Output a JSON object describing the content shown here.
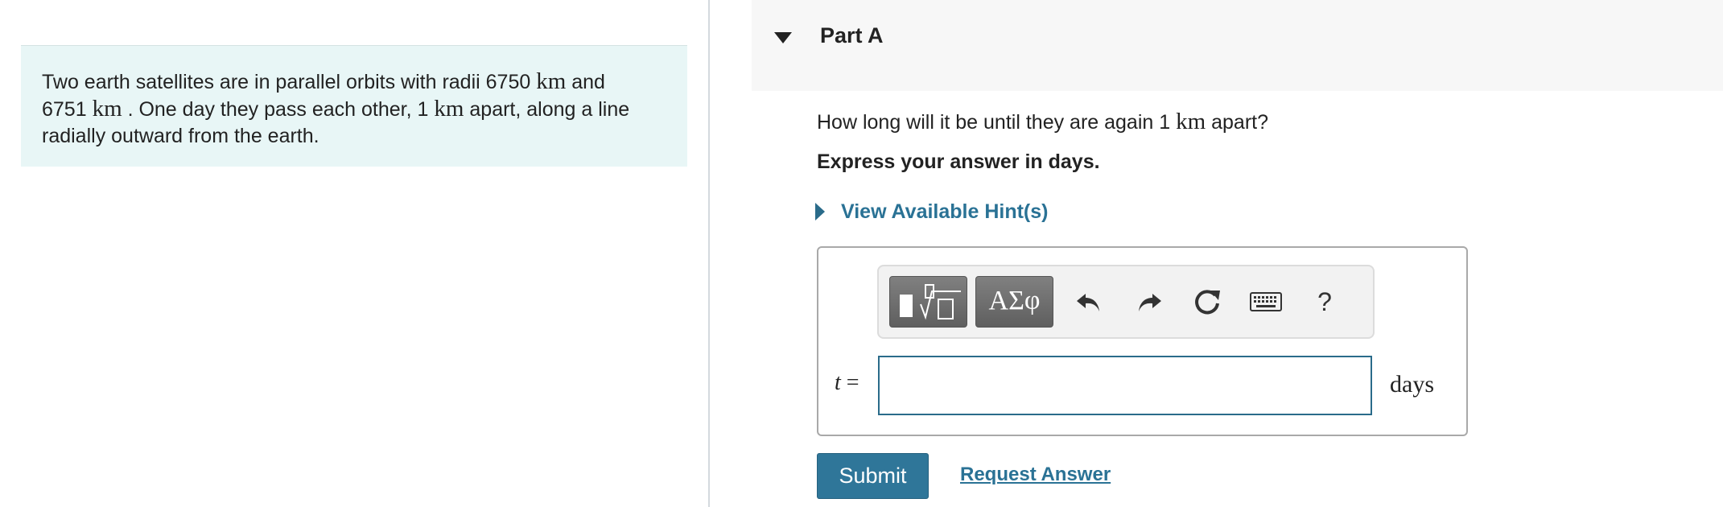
{
  "problem": {
    "line1_pre": "Two earth satellites are in parallel orbits with radii 6750 ",
    "unit_km": "km",
    "line1_post": " and",
    "line2_pre": "6751 ",
    "line2_mid": " . One day they pass each other, 1 ",
    "line2_post": " apart, along a line",
    "line3": "radially outward from the earth."
  },
  "part": {
    "title": "Part A",
    "question_pre": "How long will it be until they are again 1 ",
    "question_unit": "km",
    "question_post": " apart?",
    "instruction": "Express your answer in days.",
    "hint_label": "View Available Hint(s)"
  },
  "answer": {
    "toolbar": {
      "greek_label": "ΑΣφ",
      "help_label": "?",
      "icons": [
        "templates-icon",
        "undo-icon",
        "redo-icon",
        "reset-icon",
        "keyboard-icon",
        "help-icon"
      ]
    },
    "variable": "t",
    "equals": " =",
    "input_value": "",
    "unit": "days"
  },
  "actions": {
    "submit_label": "Submit",
    "request_label": "Request Answer"
  },
  "colors": {
    "problem_bg": "#e8f6f6",
    "link": "#2a7295",
    "submit_bg": "#2f7699",
    "header_bg": "#f7f7f7"
  }
}
